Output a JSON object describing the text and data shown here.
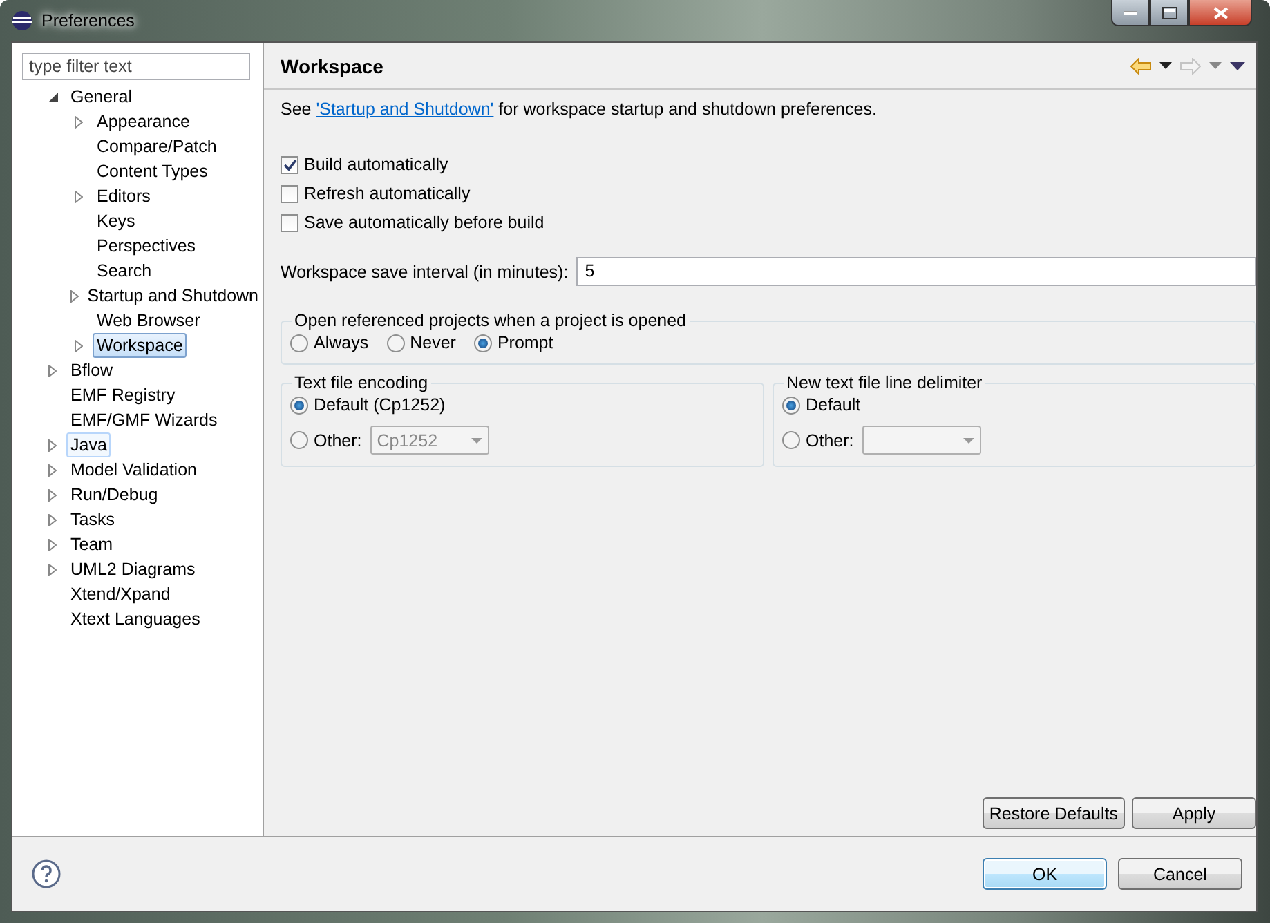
{
  "window": {
    "title": "Preferences"
  },
  "filter": {
    "placeholder": "type filter text"
  },
  "tree": [
    {
      "label": "General",
      "kind": "folder",
      "expanded": true,
      "selected": false,
      "hovered": false,
      "children": [
        {
          "label": "Appearance",
          "kind": "folder",
          "expanded": false,
          "selected": false,
          "hovered": false
        },
        {
          "label": "Compare/Patch",
          "kind": "leaf",
          "selected": false,
          "hovered": false
        },
        {
          "label": "Content Types",
          "kind": "leaf",
          "selected": false,
          "hovered": false
        },
        {
          "label": "Editors",
          "kind": "folder",
          "expanded": false,
          "selected": false,
          "hovered": false
        },
        {
          "label": "Keys",
          "kind": "leaf",
          "selected": false,
          "hovered": false
        },
        {
          "label": "Perspectives",
          "kind": "leaf",
          "selected": false,
          "hovered": false
        },
        {
          "label": "Search",
          "kind": "leaf",
          "selected": false,
          "hovered": false
        },
        {
          "label": "Startup and Shutdown",
          "kind": "folder",
          "expanded": false,
          "selected": false,
          "hovered": false
        },
        {
          "label": "Web Browser",
          "kind": "leaf",
          "selected": false,
          "hovered": false
        },
        {
          "label": "Workspace",
          "kind": "folder",
          "expanded": false,
          "selected": true,
          "hovered": false
        }
      ]
    },
    {
      "label": "Bflow",
      "kind": "folder",
      "expanded": false,
      "selected": false,
      "hovered": false
    },
    {
      "label": "EMF Registry",
      "kind": "leaf",
      "selected": false,
      "hovered": false
    },
    {
      "label": "EMF/GMF Wizards",
      "kind": "leaf",
      "selected": false,
      "hovered": false
    },
    {
      "label": "Java",
      "kind": "folder",
      "expanded": false,
      "selected": false,
      "hovered": true
    },
    {
      "label": "Model Validation",
      "kind": "folder",
      "expanded": false,
      "selected": false,
      "hovered": false
    },
    {
      "label": "Run/Debug",
      "kind": "folder",
      "expanded": false,
      "selected": false,
      "hovered": false
    },
    {
      "label": "Tasks",
      "kind": "folder",
      "expanded": false,
      "selected": false,
      "hovered": false
    },
    {
      "label": "Team",
      "kind": "folder",
      "expanded": false,
      "selected": false,
      "hovered": false
    },
    {
      "label": "UML2 Diagrams",
      "kind": "folder",
      "expanded": false,
      "selected": false,
      "hovered": false
    },
    {
      "label": "Xtend/Xpand",
      "kind": "leaf",
      "selected": false,
      "hovered": false
    },
    {
      "label": "Xtext Languages",
      "kind": "leaf",
      "selected": false,
      "hovered": false
    }
  ],
  "page": {
    "title": "Workspace",
    "navigation": {
      "back_enabled": true,
      "forward_enabled": false
    },
    "intro": {
      "before": "See ",
      "link": "'Startup and Shutdown'",
      "after": " for workspace startup and shutdown preferences."
    },
    "options": [
      {
        "label": "Build automatically",
        "checked": true
      },
      {
        "label": "Refresh automatically",
        "checked": false
      },
      {
        "label": "Save automatically before build",
        "checked": false
      }
    ],
    "save_interval": {
      "label": "Workspace save interval (in minutes):",
      "value": "5"
    },
    "open_referenced": {
      "title": "Open referenced projects when a project is opened",
      "choices": [
        {
          "label": "Always",
          "selected": false
        },
        {
          "label": "Never",
          "selected": false
        },
        {
          "label": "Prompt",
          "selected": true
        }
      ]
    },
    "encoding": {
      "title": "Text file encoding",
      "choices": [
        {
          "label": "Default (Cp1252)",
          "selected": true
        },
        {
          "label": "Other:",
          "selected": false
        }
      ],
      "combo": {
        "value": "Cp1252",
        "disabled": true
      }
    },
    "delimiter": {
      "title": "New text file line delimiter",
      "choices": [
        {
          "label": "Default",
          "selected": true
        },
        {
          "label": "Other:",
          "selected": false
        }
      ],
      "combo": {
        "disabled": true
      }
    },
    "buttons": [
      "Restore Defaults",
      "Apply"
    ]
  },
  "dialog_buttons": [
    {
      "label": "OK",
      "default": true
    },
    {
      "label": "Cancel",
      "default": false
    }
  ]
}
